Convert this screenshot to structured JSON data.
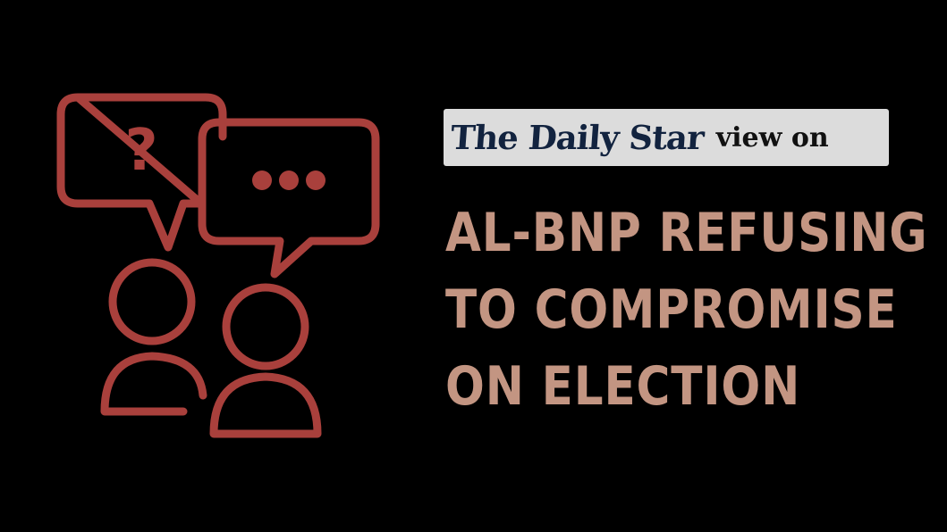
{
  "colors": {
    "background": "#000000",
    "icon_stroke": "#a9403c",
    "headline": "#c39582",
    "masthead_bg": "#dcdcdc",
    "masthead_logo": "#12233f"
  },
  "illustration": {
    "icons": [
      "question-speech-bubble-icon",
      "ellipsis-speech-bubble-icon",
      "person-icon",
      "person-icon"
    ],
    "question_glyph": "?"
  },
  "masthead": {
    "logo_text": "The Daily Star",
    "suffix": "view on"
  },
  "headline": {
    "lines": [
      "AL-BNP REFUSING",
      "TO COMPROMISE",
      "ON ELECTION"
    ]
  }
}
